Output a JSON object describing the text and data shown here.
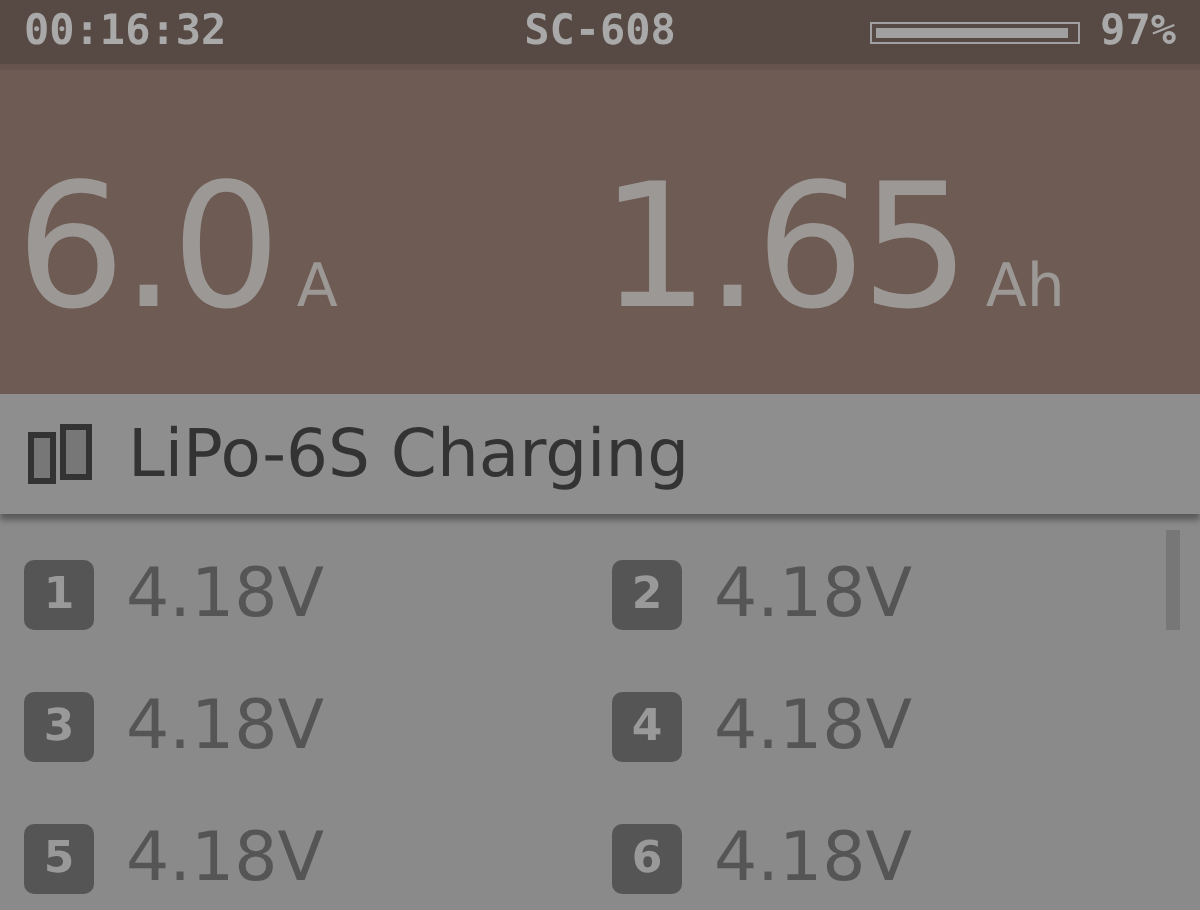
{
  "status_bar": {
    "time": "00:16:32",
    "model": "SC-608",
    "battery": {
      "level": 0.97,
      "reading": "97%"
    }
  },
  "readings": [
    {
      "value": "6.0",
      "unit": "A"
    },
    {
      "value": "1.65",
      "unit": "Ah"
    }
  ],
  "mode": {
    "title": "LiPo-6S Charging"
  },
  "cells": [
    {
      "index": "1",
      "voltage": "4.18V"
    },
    {
      "index": "2",
      "voltage": "4.18V"
    },
    {
      "index": "3",
      "voltage": "4.18V"
    },
    {
      "index": "4",
      "voltage": "4.18V"
    },
    {
      "index": "5",
      "voltage": "4.18V"
    },
    {
      "index": "6",
      "voltage": "4.18V"
    }
  ]
}
